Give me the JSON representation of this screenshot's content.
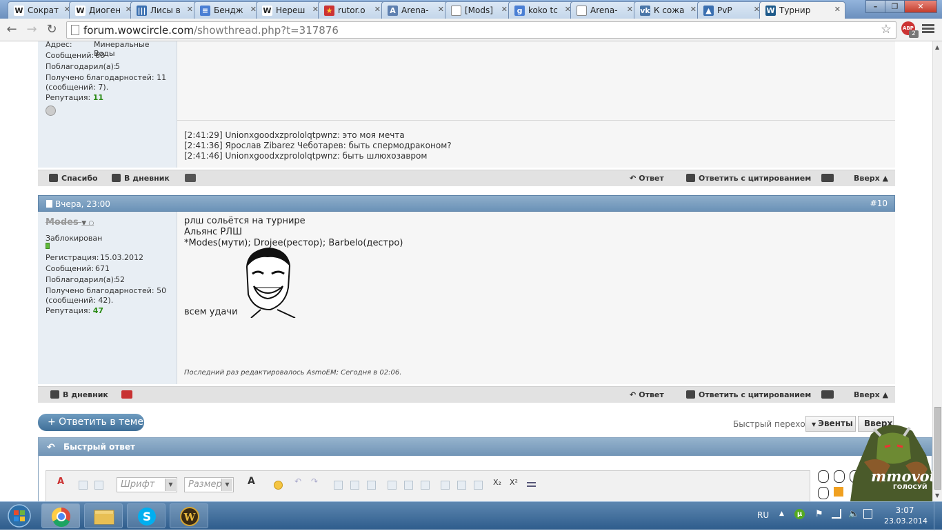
{
  "browser": {
    "tabs": [
      {
        "label": "Сократ",
        "icon": "W"
      },
      {
        "label": "Диоген",
        "icon": "W"
      },
      {
        "label": "Лисы в",
        "icon": "bars"
      },
      {
        "label": "Бендж",
        "icon": "doc-blue"
      },
      {
        "label": "Нереш",
        "icon": "W"
      },
      {
        "label": "rutor.o",
        "icon": "rutor"
      },
      {
        "label": "Arena-",
        "icon": "arena"
      },
      {
        "label": "[Mods]",
        "icon": "page"
      },
      {
        "label": "koko tc",
        "icon": "g"
      },
      {
        "label": "Arena-",
        "icon": "page"
      },
      {
        "label": "К сожа",
        "icon": "vk"
      },
      {
        "label": "PvP",
        "icon": "pvp"
      },
      {
        "label": "Турнир",
        "icon": "wc"
      }
    ],
    "url_host": "forum.wowcircle.com",
    "url_path": "/showthread.php?t=317876",
    "abp_label": "ABP",
    "abp_count": "2"
  },
  "post9": {
    "address_label": "Адрес:",
    "address_value": "Минеральные Воды",
    "messages_label": "Сообщений:",
    "messages_value": "60",
    "thanked_label": "Поблагодарил(а):",
    "thanked_value": "5",
    "received_line1": "Получено благодарностей: 11",
    "received_line2": "(сообщений: 7).",
    "rep_label": "Репутация:",
    "rep_value": "11",
    "chat": [
      "[2:41:29] Unionxgoodxzprololqtpwnz: это моя мечта",
      "[2:41:36] Ярослав Zibarez Чеботарев: быть спермодраконом?",
      "[2:41:46] Unionxgoodxzprololqtpwnz: быть шлюхозавром"
    ],
    "footer": {
      "thanks": "Спасибо",
      "diary": "В дневник",
      "reply": "Ответ",
      "quote": "Ответить с цитированием",
      "up": "Вверх ▲"
    }
  },
  "post10": {
    "date": "Вчера, 23:00",
    "number": "#10",
    "username": "Modes",
    "status": "Заблокирован",
    "reg_label": "Регистрация:",
    "reg_value": "15.03.2012",
    "messages_label": "Сообщений:",
    "messages_value": "671",
    "thanked_label": "Поблагодарил(а):",
    "thanked_value": "52",
    "received_line1": "Получено благодарностей: 50",
    "received_line2": "(сообщений: 42).",
    "rep_label": "Репутация:",
    "rep_value": "47",
    "lines": [
      "рлш сольётся на турнире",
      "Альянс РЛШ",
      "*Modes(мути); Drojee(рестор); Barbelo(дестро)"
    ],
    "closing": "всем удачи",
    "edited": "Последний раз редактировалось AsmoEM; Сегодня в 02:06.",
    "footer": {
      "diary": "В дневник",
      "reply": "Ответ",
      "quote": "Ответить с цитированием",
      "up": "Вверх ▲"
    }
  },
  "thread": {
    "reply_button": "+ Ответить в теме",
    "quick_jump_label": "Быстрый переход",
    "quick_jump_value": "Эвенты",
    "up_button": "Вверх",
    "quick_reply_title": "Быстрый ответ",
    "font_placeholder": "Шрифт",
    "size_placeholder": "Размер"
  },
  "mmovote": {
    "title": "mmovote",
    "subtitle": "ГОЛОСУЙ"
  },
  "tray": {
    "lang": "RU",
    "time": "3:07",
    "date": "23.03.2014"
  },
  "colors": {
    "accent": "#6b92b7",
    "rep_green": "#2a8a14"
  }
}
